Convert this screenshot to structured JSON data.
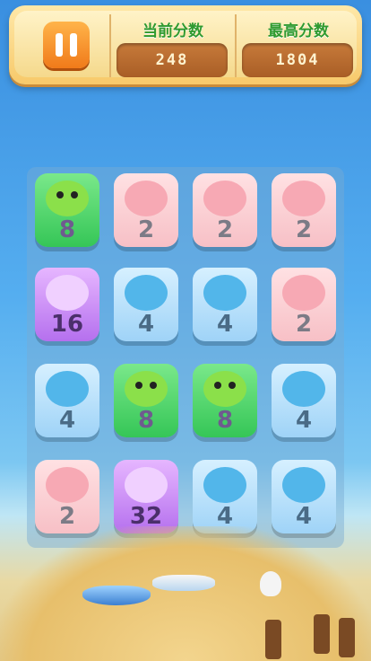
{
  "hud": {
    "current_score_label": "当前分数",
    "current_score": "248",
    "best_score_label": "最高分数",
    "best_score": "1804"
  },
  "board": {
    "rows": [
      [
        {
          "value": "8",
          "kind": "frog"
        },
        {
          "value": "2",
          "kind": "pig"
        },
        {
          "value": "2",
          "kind": "pig"
        },
        {
          "value": "2",
          "kind": "pig"
        }
      ],
      [
        {
          "value": "16",
          "kind": "cat"
        },
        {
          "value": "4",
          "kind": "seal"
        },
        {
          "value": "4",
          "kind": "seal"
        },
        {
          "value": "2",
          "kind": "pig"
        }
      ],
      [
        {
          "value": "4",
          "kind": "seal"
        },
        {
          "value": "8",
          "kind": "frog"
        },
        {
          "value": "8",
          "kind": "frog"
        },
        {
          "value": "4",
          "kind": "seal"
        }
      ],
      [
        {
          "value": "2",
          "kind": "pig"
        },
        {
          "value": "32",
          "kind": "cat"
        },
        {
          "value": "4",
          "kind": "seal"
        },
        {
          "value": "4",
          "kind": "seal"
        }
      ]
    ]
  }
}
